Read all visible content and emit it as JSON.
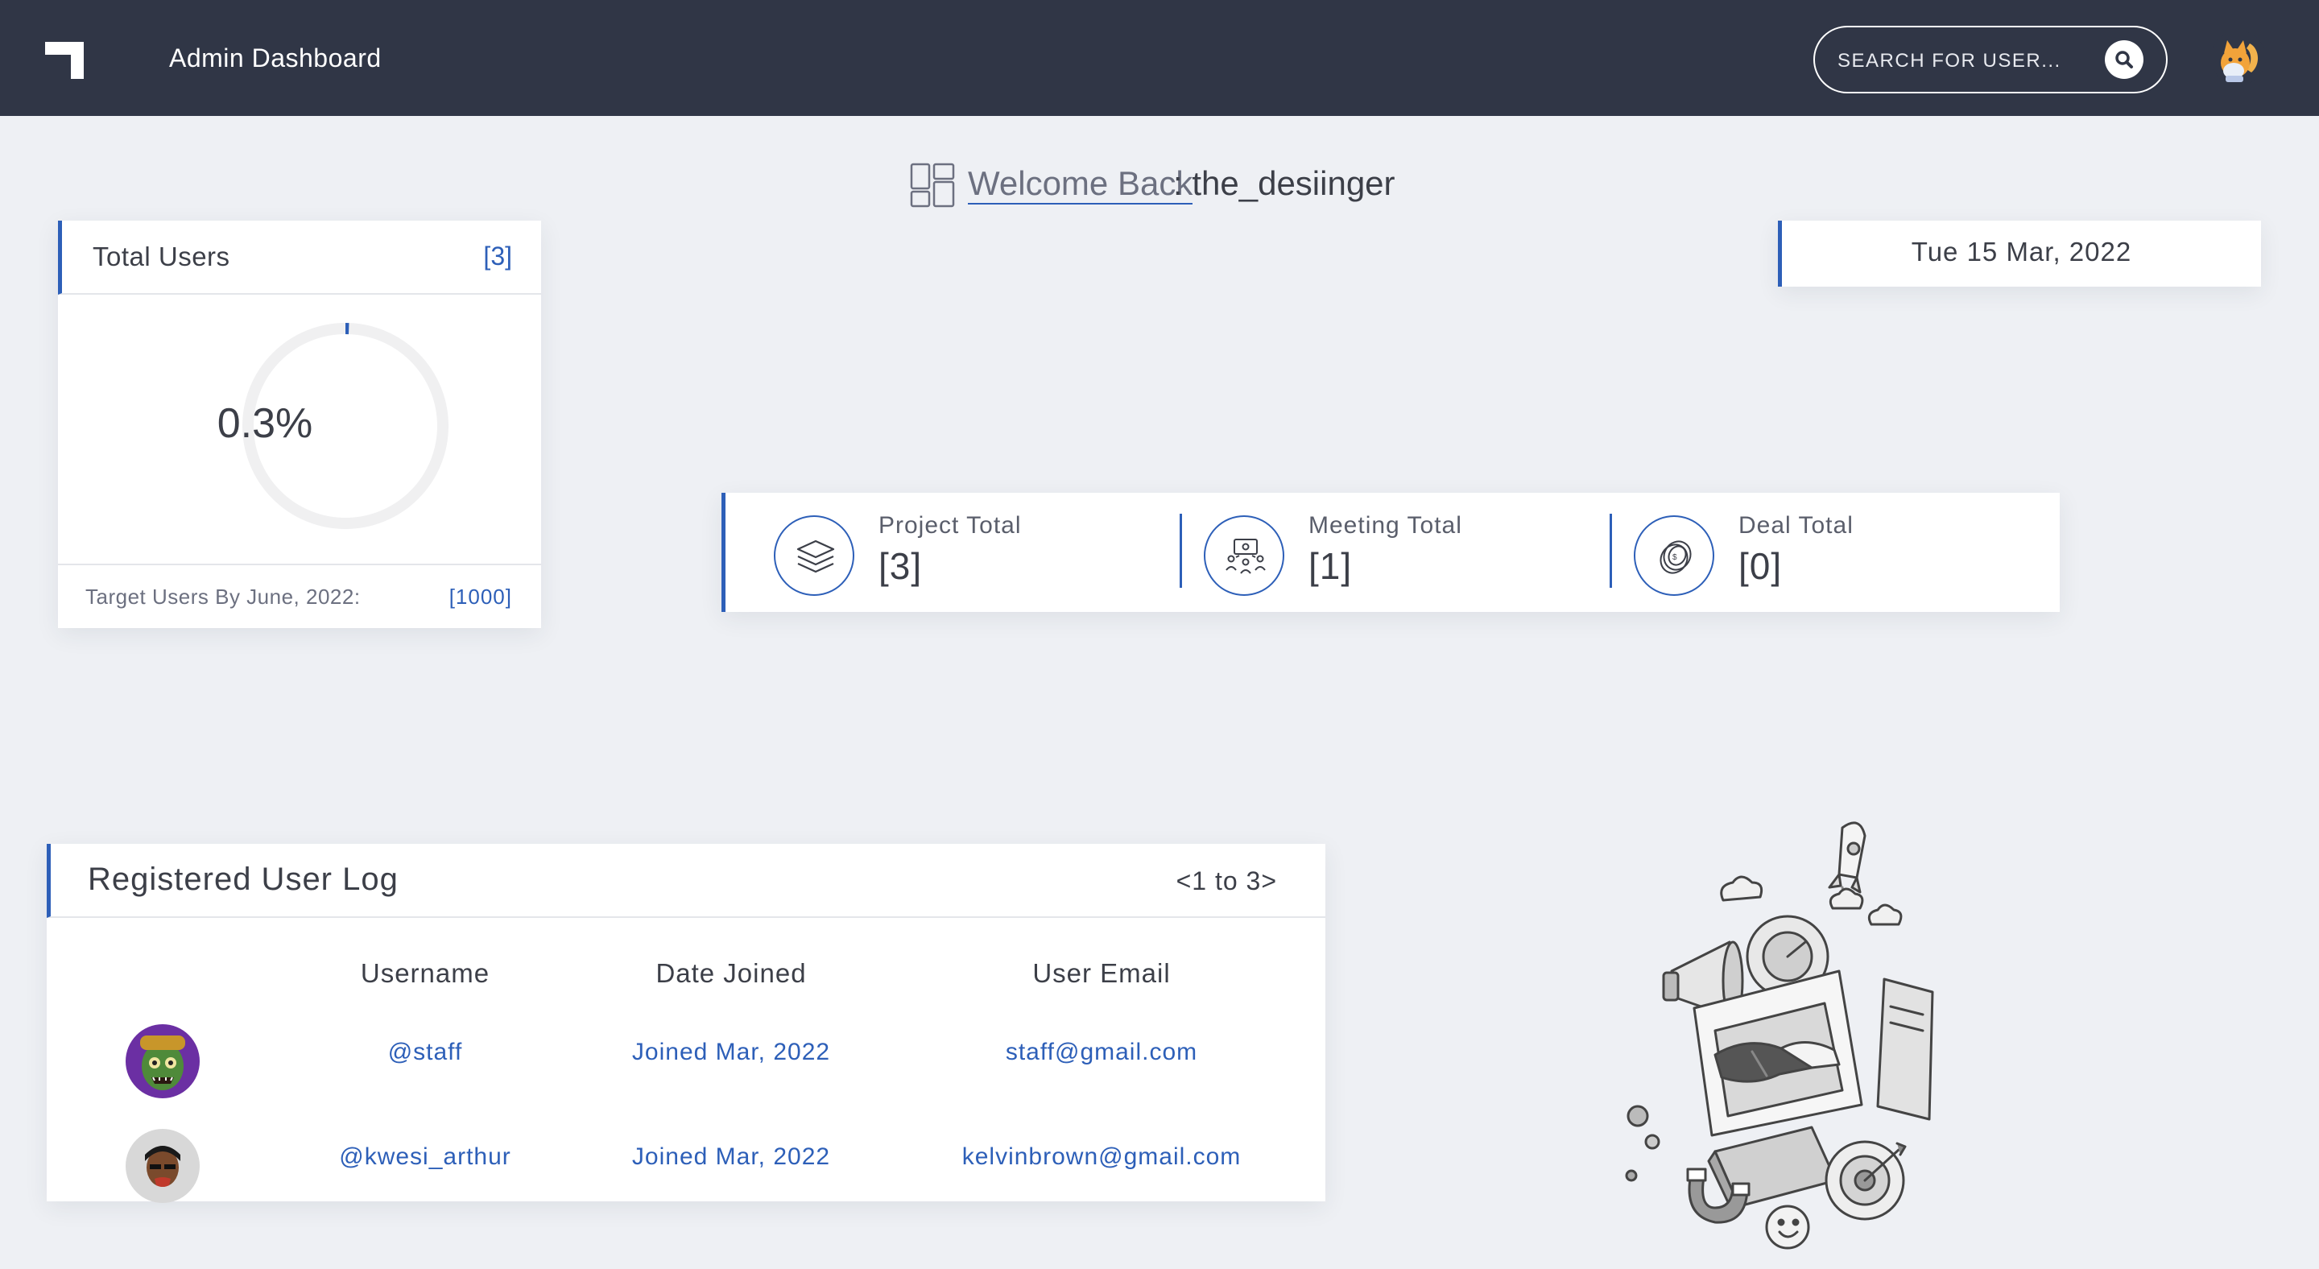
{
  "header": {
    "app_title": "Admin Dashboard",
    "search": {
      "placeholder": "SEARCH FOR USER..."
    },
    "icons": {
      "logo": "logo-mark-icon",
      "search": "search-icon",
      "avatar": "cat-avatar-icon"
    }
  },
  "welcome": {
    "label": "Welcome Back",
    "separator": ": ",
    "username": "the_desiinger",
    "icon": "dashboard-grid-icon"
  },
  "users_card": {
    "title": "Total Users",
    "count": "[3]",
    "percent_text": "0.3%",
    "progress_fraction": 0.003,
    "target_label": "Target Users By June, 2022:",
    "target_value": "[1000]"
  },
  "date_card": {
    "date": "Tue 15 Mar, 2022"
  },
  "stats": [
    {
      "label": "Project Total",
      "value": "[3]",
      "icon": "layers-icon"
    },
    {
      "label": "Meeting Total",
      "value": "[1]",
      "icon": "meeting-icon"
    },
    {
      "label": "Deal Total",
      "value": "[0]",
      "icon": "coin-icon"
    }
  ],
  "log": {
    "title": "Registered User Log",
    "pager": "<1 to 3>",
    "columns": [
      "Username",
      "Date Joined",
      "User Email"
    ],
    "rows": [
      {
        "username": "@staff",
        "date_joined": "Joined Mar, 2022",
        "email": "staff@gmail.com",
        "avatar": "zombie-avatar-icon"
      },
      {
        "username": "@kwesi_arthur",
        "date_joined": "Joined Mar, 2022",
        "email": "kelvinbrown@gmail.com",
        "avatar": "person-avatar-icon"
      }
    ]
  },
  "colors": {
    "navbar": "#303646",
    "accent": "#2d5fb8",
    "background": "#eef0f4",
    "text": "#3c3f48"
  }
}
